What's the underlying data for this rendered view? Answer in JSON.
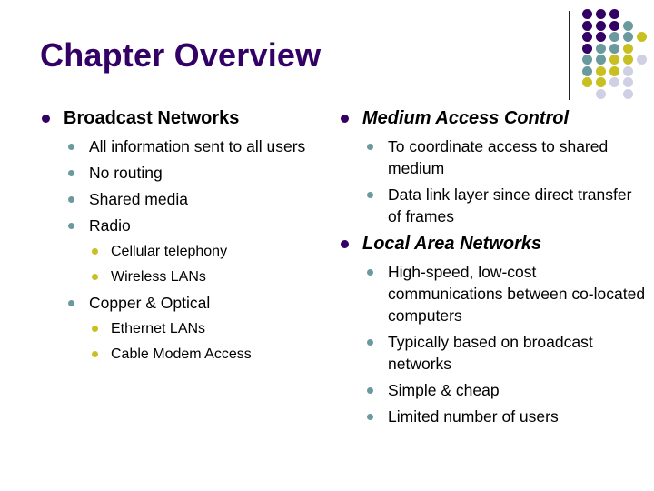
{
  "slide": {
    "title": "Chapter Overview",
    "colors": {
      "title": "#330066",
      "bullet_level1": "#330066",
      "bullet_level2": "#6b9a9e",
      "bullet_level3": "#c8c020",
      "dot_purple": "#330066",
      "dot_teal": "#6b9a9e",
      "dot_yellow": "#c8c020",
      "dot_lavender": "#d0d0e4"
    },
    "decoration": {
      "dot_grid": [
        [
          "purple",
          "purple",
          "purple",
          "",
          ""
        ],
        [
          "purple",
          "purple",
          "purple",
          "teal",
          ""
        ],
        [
          "purple",
          "purple",
          "teal",
          "teal",
          "yellow"
        ],
        [
          "purple",
          "teal",
          "teal",
          "yellow",
          ""
        ],
        [
          "teal",
          "teal",
          "yellow",
          "yellow",
          "lavender"
        ],
        [
          "teal",
          "yellow",
          "yellow",
          "lavender",
          ""
        ],
        [
          "yellow",
          "yellow",
          "lavender",
          "lavender",
          ""
        ],
        [
          "",
          "lavender",
          "",
          "lavender",
          ""
        ]
      ]
    },
    "left_column": {
      "heading": "Broadcast Networks",
      "items": [
        {
          "text": "All information sent to all users",
          "level": 2
        },
        {
          "text": "No routing",
          "level": 2
        },
        {
          "text": "Shared media",
          "level": 2
        },
        {
          "text": "Radio",
          "level": 2
        },
        {
          "text": "Cellular telephony",
          "level": 3
        },
        {
          "text": "Wireless LANs",
          "level": 3
        },
        {
          "text": "Copper & Optical",
          "level": 2
        },
        {
          "text": "Ethernet LANs",
          "level": 3
        },
        {
          "text": "Cable Modem Access",
          "level": 3
        }
      ]
    },
    "right_column": {
      "sections": [
        {
          "heading": "Medium Access Control",
          "items": [
            "To coordinate access to shared medium",
            "Data link layer since direct transfer of frames"
          ]
        },
        {
          "heading": "Local Area Networks",
          "items": [
            "High-speed, low-cost communications between co-located computers",
            "Typically based on broadcast networks",
            "Simple & cheap",
            "Limited number of users"
          ]
        }
      ]
    }
  }
}
